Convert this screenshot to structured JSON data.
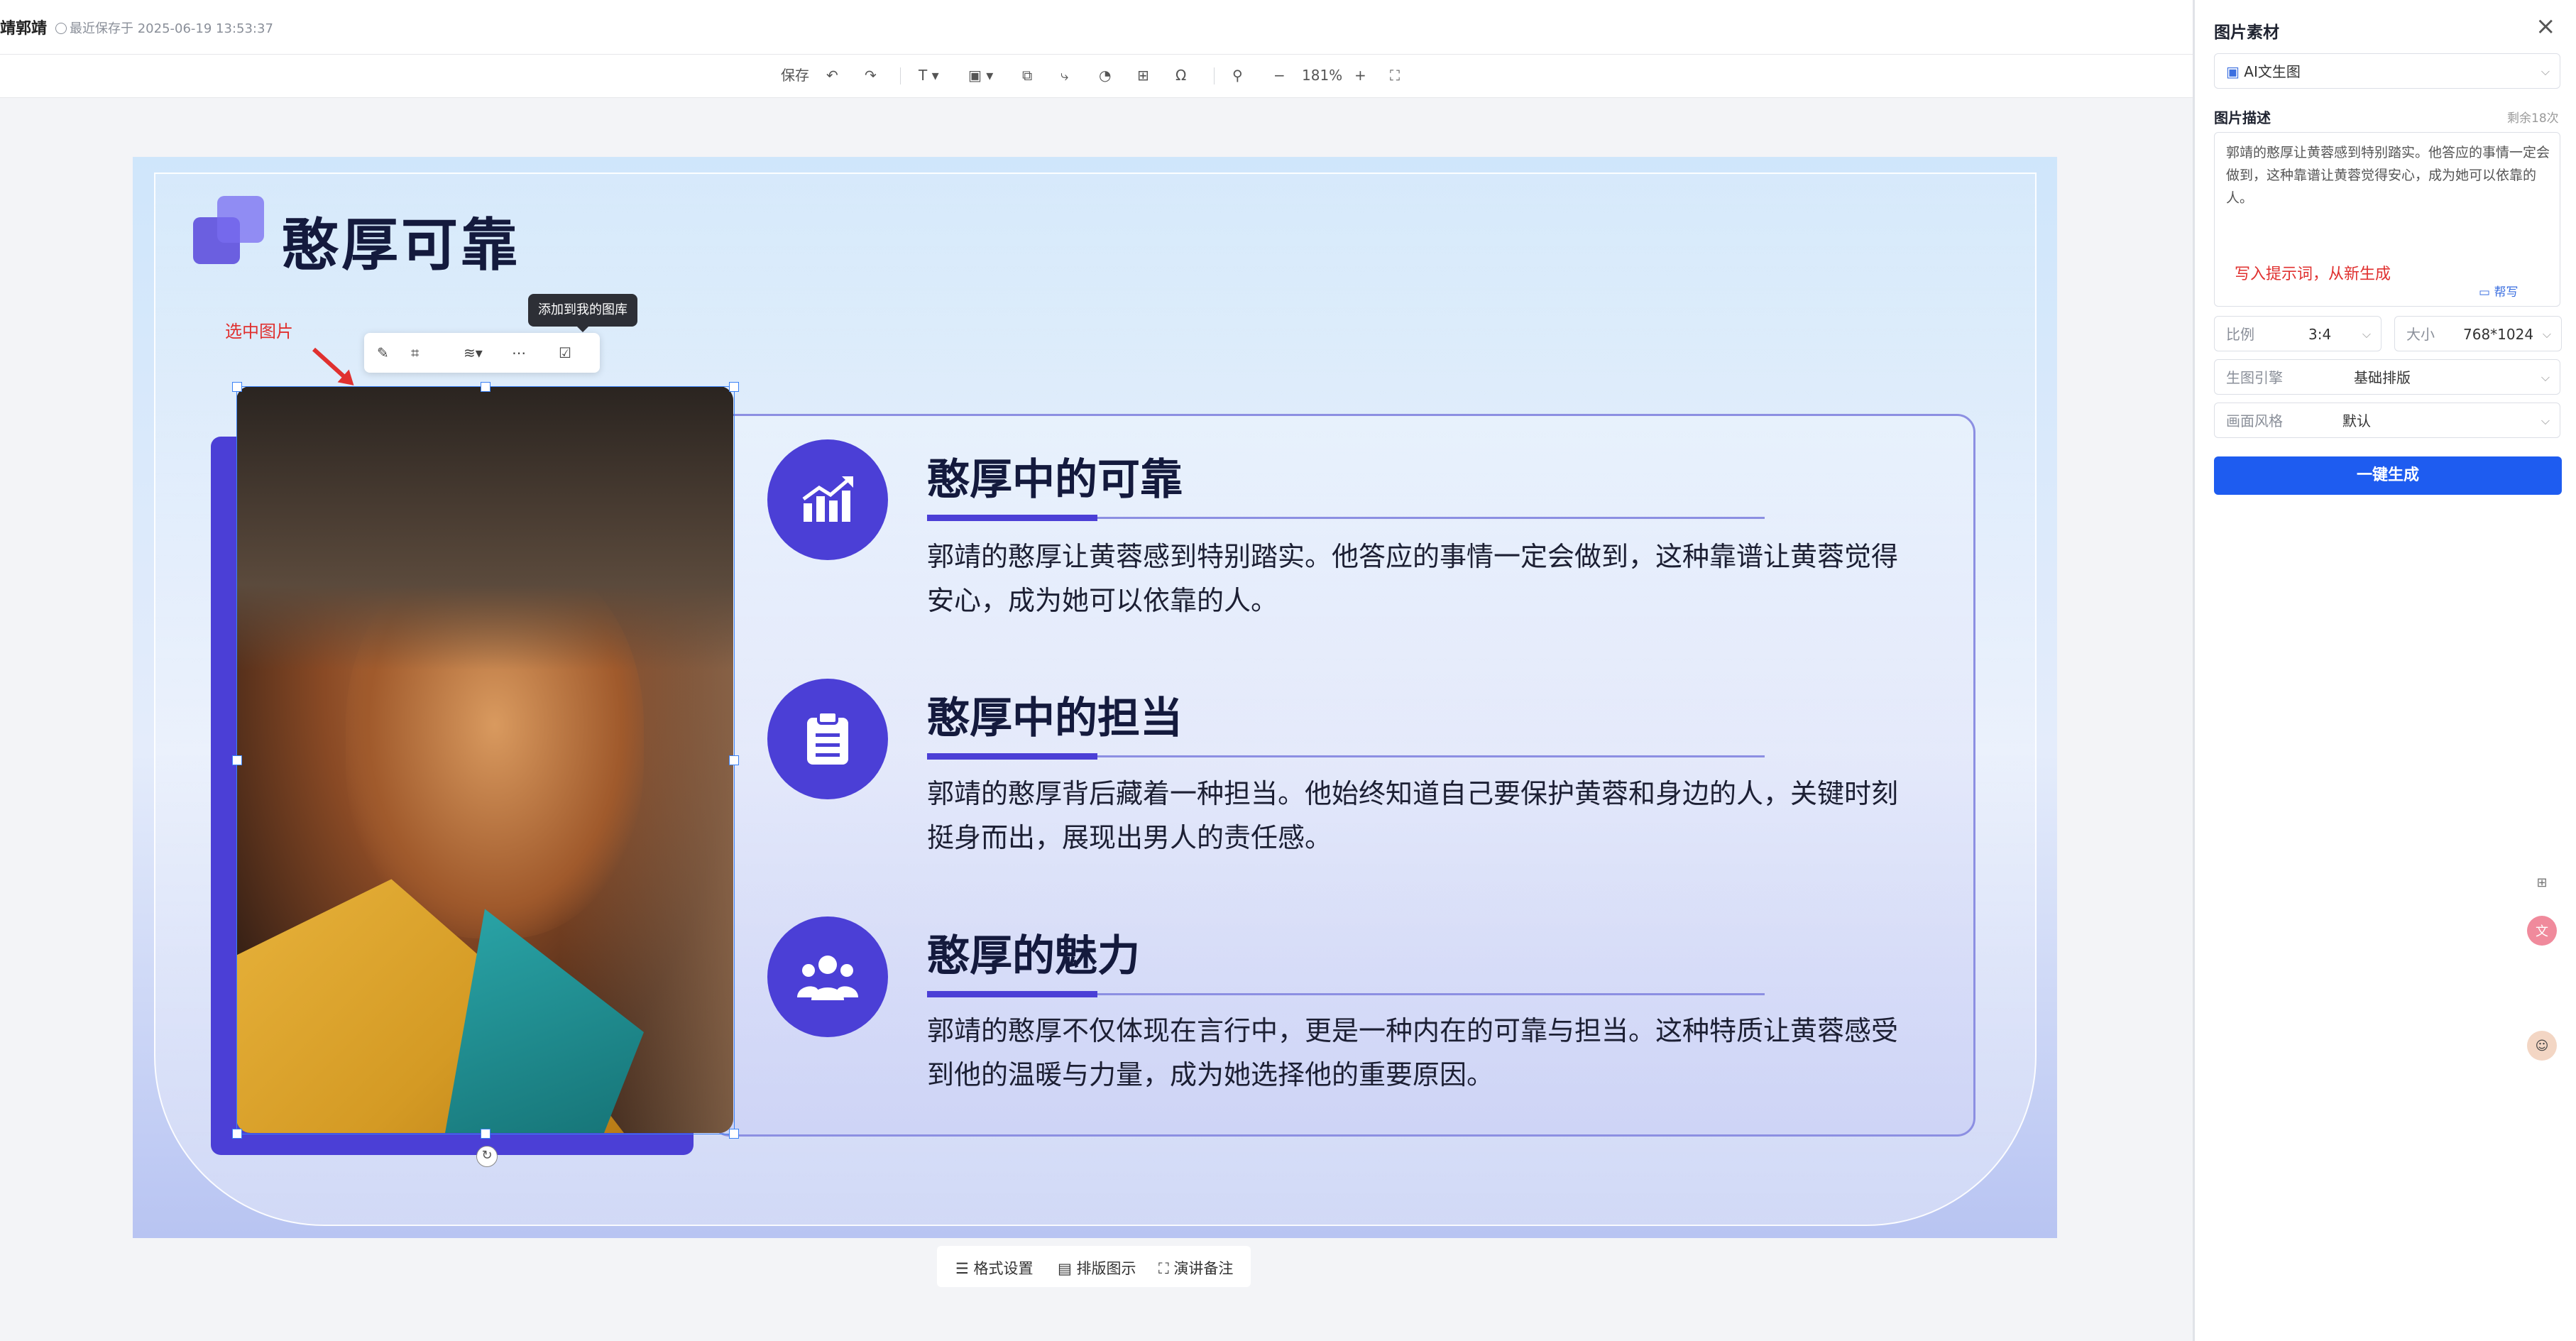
{
  "header": {
    "doc_title": "靖郭靖",
    "save_status": "最近保存于 2025-06-19 13:53:37"
  },
  "toolbar": {
    "save_label": "保存",
    "undo_icon": "undo-icon",
    "redo_icon": "redo-icon",
    "text_icon": "T",
    "zoom": "181%",
    "zoom_minus": "−",
    "zoom_plus": "+"
  },
  "slide": {
    "title": "憨厚可靠",
    "selected_label": "选中图片",
    "tooltip": "添加到我的图库",
    "sections": [
      {
        "title": "憨厚中的可靠",
        "body": "郭靖的憨厚让黄蓉感到特别踏实。他答应的事情一定会做到，这种靠谱让黄蓉觉得安心，成为她可以依靠的人。",
        "icon": "chart-up-icon"
      },
      {
        "title": "憨厚中的担当",
        "body": "郭靖的憨厚背后藏着一种担当。他始终知道自己要保护黄蓉和身边的人，关键时刻挺身而出，展现出男人的责任感。",
        "icon": "clipboard-icon"
      },
      {
        "title": "憨厚的魅力",
        "body": "郭靖的憨厚不仅体现在言行中，更是一种内在的可靠与担当。这种特质让黄蓉感受到他的温暖与力量，成为她选择他的重要原因。",
        "icon": "people-icon"
      }
    ]
  },
  "bottom_tabs": [
    {
      "label": "格式设置",
      "icon": "format-icon"
    },
    {
      "label": "排版图示",
      "icon": "layout-icon"
    },
    {
      "label": "演讲备注",
      "icon": "notes-icon"
    }
  ],
  "panel": {
    "title": "图片素材",
    "mode_select": "AI文生图",
    "desc_label": "图片描述",
    "remaining": "剩余18次",
    "description": "郭靖的憨厚让黄蓉感到特别踏实。他答应的事情一定会做到，这种靠谱让黄蓉觉得安心，成为她可以依靠的人。",
    "hint": "写入提示词，从新生成",
    "help_label": "帮写",
    "ratio_label": "比例",
    "ratio_value": "3:4",
    "size_label": "大小",
    "size_value": "768*1024",
    "engine_label": "生图引擎",
    "engine_value": "基础排版",
    "style_label": "画面风格",
    "style_value": "默认",
    "generate_button": "一键生成"
  },
  "colors": {
    "accent": "#4b3fd6",
    "primary_button": "#1e5cf0",
    "annotation": "#e0302f"
  }
}
